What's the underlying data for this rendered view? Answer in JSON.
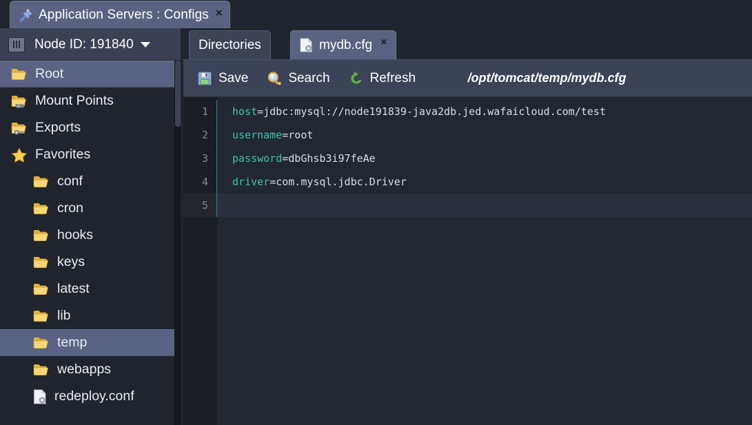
{
  "window": {
    "tab_title": "Application Servers : Configs",
    "tab_icon": "wrench-screwdriver-icon",
    "close_label": "×"
  },
  "sidebar": {
    "node_bar": {
      "icon": "server-icon",
      "label": "Node ID: 191840",
      "caret": "chevron-down-icon"
    },
    "items": [
      {
        "label": "Root",
        "icon": "folder-icon",
        "selected": true,
        "indent": false
      },
      {
        "label": "Mount Points",
        "icon": "folder-mount-icon",
        "selected": false,
        "indent": false
      },
      {
        "label": "Exports",
        "icon": "folder-export-icon",
        "selected": false,
        "indent": false
      },
      {
        "label": "Favorites",
        "icon": "star-icon",
        "selected": false,
        "indent": false
      },
      {
        "label": "conf",
        "icon": "folder-icon",
        "selected": false,
        "indent": true
      },
      {
        "label": "cron",
        "icon": "folder-icon",
        "selected": false,
        "indent": true
      },
      {
        "label": "hooks",
        "icon": "folder-icon",
        "selected": false,
        "indent": true
      },
      {
        "label": "keys",
        "icon": "folder-icon",
        "selected": false,
        "indent": true
      },
      {
        "label": "latest",
        "icon": "folder-icon",
        "selected": false,
        "indent": true
      },
      {
        "label": "lib",
        "icon": "folder-icon",
        "selected": false,
        "indent": true
      },
      {
        "label": "temp",
        "icon": "folder-icon",
        "selected": true,
        "indent": true
      },
      {
        "label": "webapps",
        "icon": "folder-icon",
        "selected": false,
        "indent": true
      },
      {
        "label": "redeploy.conf",
        "icon": "file-config-icon",
        "selected": false,
        "indent": true
      }
    ]
  },
  "editor": {
    "tabs": [
      {
        "label": "Directories",
        "icon": null,
        "active": false,
        "closable": false
      },
      {
        "label": "mydb.cfg",
        "icon": "file-config-icon",
        "active": true,
        "closable": true,
        "close_label": "×"
      }
    ],
    "toolbar": {
      "save_label": "Save",
      "save_icon": "floppy-disk-icon",
      "search_label": "Search",
      "search_icon": "magnifier-icon",
      "refresh_label": "Refresh",
      "refresh_icon": "refresh-arrow-icon"
    },
    "file_path": "/opt/tomcat/temp/mydb.cfg",
    "lines": [
      {
        "num": "1",
        "key": "host",
        "value": "=jdbc:mysql://node191839-java2db.jed.wafaicloud.com/test"
      },
      {
        "num": "2",
        "key": "username",
        "value": "=root"
      },
      {
        "num": "3",
        "key": "password",
        "value": "=dbGhsb3i97feAe"
      },
      {
        "num": "4",
        "key": "driver",
        "value": "=com.mysql.jdbc.Driver"
      },
      {
        "num": "5",
        "key": "",
        "value": ""
      }
    ],
    "active_line": 5
  },
  "colors": {
    "window_bg": "#20242c",
    "panel_bg": "#3d4357",
    "tab_active": "#5b6281",
    "selection": "#5a6384",
    "editor_bg": "#212831",
    "gutter_bg": "#1b1e24",
    "key_color": "#3fc2b0",
    "text_color": "#d7dde5",
    "folder_color": "#f0c75e"
  }
}
